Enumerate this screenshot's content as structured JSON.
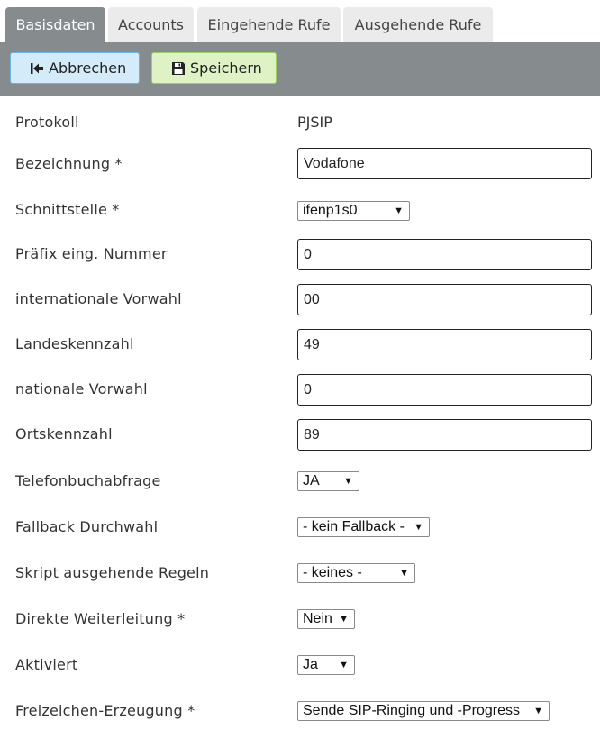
{
  "tabs": [
    {
      "label": "Basisdaten",
      "active": true
    },
    {
      "label": "Accounts",
      "active": false
    },
    {
      "label": "Eingehende Rufe",
      "active": false
    },
    {
      "label": "Ausgehende Rufe",
      "active": false
    }
  ],
  "toolbar": {
    "cancel_label": "Abbrechen",
    "cancel_icon": "exit-arrow-icon",
    "save_label": "Speichern",
    "save_icon": "floppy-disk-icon"
  },
  "form": {
    "protokoll": {
      "label": "Protokoll",
      "value": "PJSIP"
    },
    "bezeichnung": {
      "label": "Bezeichnung *",
      "value": "Vodafone"
    },
    "schnittstelle": {
      "label": "Schnittstelle *",
      "value": "ifenp1s0"
    },
    "praefix": {
      "label": "Präfix eing. Nummer",
      "value": "0"
    },
    "intl_vorwahl": {
      "label": "internationale Vorwahl",
      "value": "00"
    },
    "landeskennzahl": {
      "label": "Landeskennzahl",
      "value": "49"
    },
    "nat_vorwahl": {
      "label": "nationale Vorwahl",
      "value": "0"
    },
    "ortskennzahl": {
      "label": "Ortskennzahl",
      "value": "89"
    },
    "telefonbuch": {
      "label": "Telefonbuchabfrage",
      "value": "JA"
    },
    "fallback": {
      "label": "Fallback Durchwahl",
      "value": "- kein Fallback -"
    },
    "skript": {
      "label": "Skript ausgehende Regeln",
      "value": "- keines -"
    },
    "weiterleitung": {
      "label": "Direkte Weiterleitung *",
      "value": "Nein"
    },
    "aktiviert": {
      "label": "Aktiviert",
      "value": "Ja"
    },
    "freizeichen": {
      "label": "Freizeichen-Erzeugung *",
      "value": "Sende SIP-Ringing und -Progress"
    }
  },
  "colors": {
    "toolbar_bg": "#868b8e",
    "tab_bg": "#ebebeb",
    "cancel_bg": "#d4ecfa",
    "save_bg": "#dff2c6"
  }
}
